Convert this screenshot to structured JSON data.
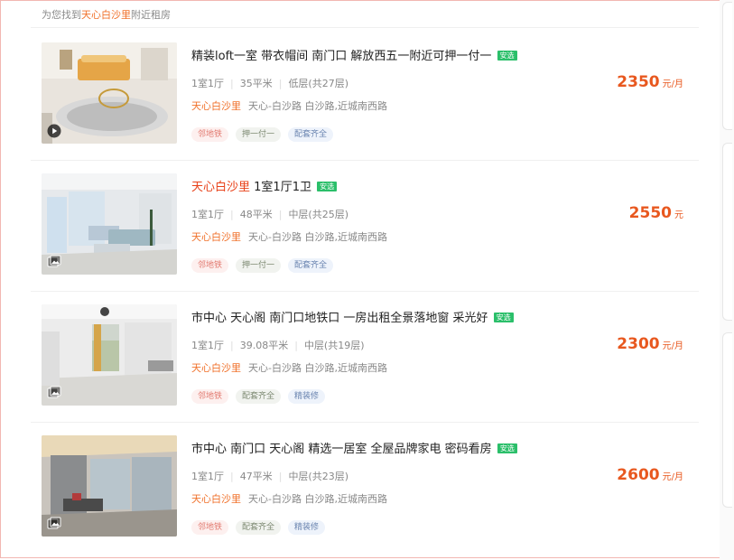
{
  "header": {
    "prefix": "为您找到",
    "community": "天心白沙里",
    "suffix": "附近租房"
  },
  "listings": [
    {
      "title": "精装loft一室 带衣帽间 南门口 解放西五一附近可押一付一",
      "title_highlight": "",
      "badge": "安选",
      "layout": "1室1厅",
      "area": "35平米",
      "floor": "低层(共27层)",
      "community": "天心白沙里",
      "address": "天心-白沙路 白沙路,近城南西路",
      "tags": [
        "邻地铁",
        "押一付一",
        "配套齐全"
      ],
      "price": "2350",
      "unit": "元/月",
      "media_icon": "play-icon"
    },
    {
      "title": "1室1厅1卫",
      "title_highlight": "天心白沙里",
      "badge": "安选",
      "layout": "1室1厅",
      "area": "48平米",
      "floor": "中层(共25层)",
      "community": "天心白沙里",
      "address": "天心-白沙路 白沙路,近城南西路",
      "tags": [
        "邻地铁",
        "押一付一",
        "配套齐全"
      ],
      "price": "2550",
      "unit": "元",
      "media_icon": "gallery-icon"
    },
    {
      "title": "市中心 天心阁 南门口地铁口 一房出租全景落地窗 采光好",
      "title_highlight": "",
      "badge": "安选",
      "layout": "1室1厅",
      "area": "39.08平米",
      "floor": "中层(共19层)",
      "community": "天心白沙里",
      "address": "天心-白沙路 白沙路,近城南西路",
      "tags": [
        "邻地铁",
        "配套齐全",
        "精装修"
      ],
      "price": "2300",
      "unit": "元/月",
      "media_icon": "gallery-icon"
    },
    {
      "title": "市中心 南门口 天心阁 精选一居室 全屋品牌家电 密码看房",
      "title_highlight": "",
      "badge": "安选",
      "layout": "1室1厅",
      "area": "47平米",
      "floor": "中层(共23层)",
      "community": "天心白沙里",
      "address": "天心-白沙路 白沙路,近城南西路",
      "tags": [
        "邻地铁",
        "配套齐全",
        "精装修"
      ],
      "price": "2600",
      "unit": "元/月",
      "media_icon": "gallery-icon"
    }
  ],
  "colors": {
    "accent_orange": "#f0722c",
    "price_orange": "#e8581f",
    "badge_green": "#2bbf6a"
  }
}
